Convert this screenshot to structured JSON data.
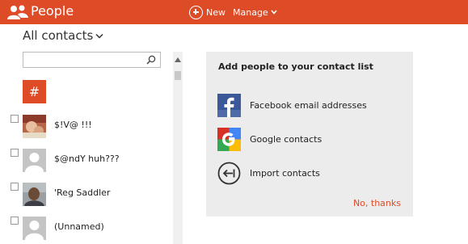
{
  "header": {
    "title": "People",
    "new_label": "New",
    "manage_label": "Manage"
  },
  "contacts_view": {
    "label": "All contacts"
  },
  "search": {
    "placeholder": ""
  },
  "index_tile": "#",
  "contacts": [
    {
      "name": "$!V@ !!!",
      "avatar": "photo-1"
    },
    {
      "name": "$@ndY huh???",
      "avatar": "default"
    },
    {
      "name": "'Reg Saddler",
      "avatar": "photo-2"
    },
    {
      "name": "(Unnamed)",
      "avatar": "default"
    }
  ],
  "panel": {
    "title": "Add people to your contact list",
    "options": [
      {
        "label": "Facebook email addresses",
        "icon": "facebook-icon"
      },
      {
        "label": "Google contacts",
        "icon": "google-icon"
      },
      {
        "label": "Import contacts",
        "icon": "import-icon"
      }
    ],
    "dismiss_label": "No, thanks"
  },
  "colors": {
    "accent": "#dd4b27",
    "panel_bg": "#ececec",
    "facebook_blue": "#3b5998"
  }
}
